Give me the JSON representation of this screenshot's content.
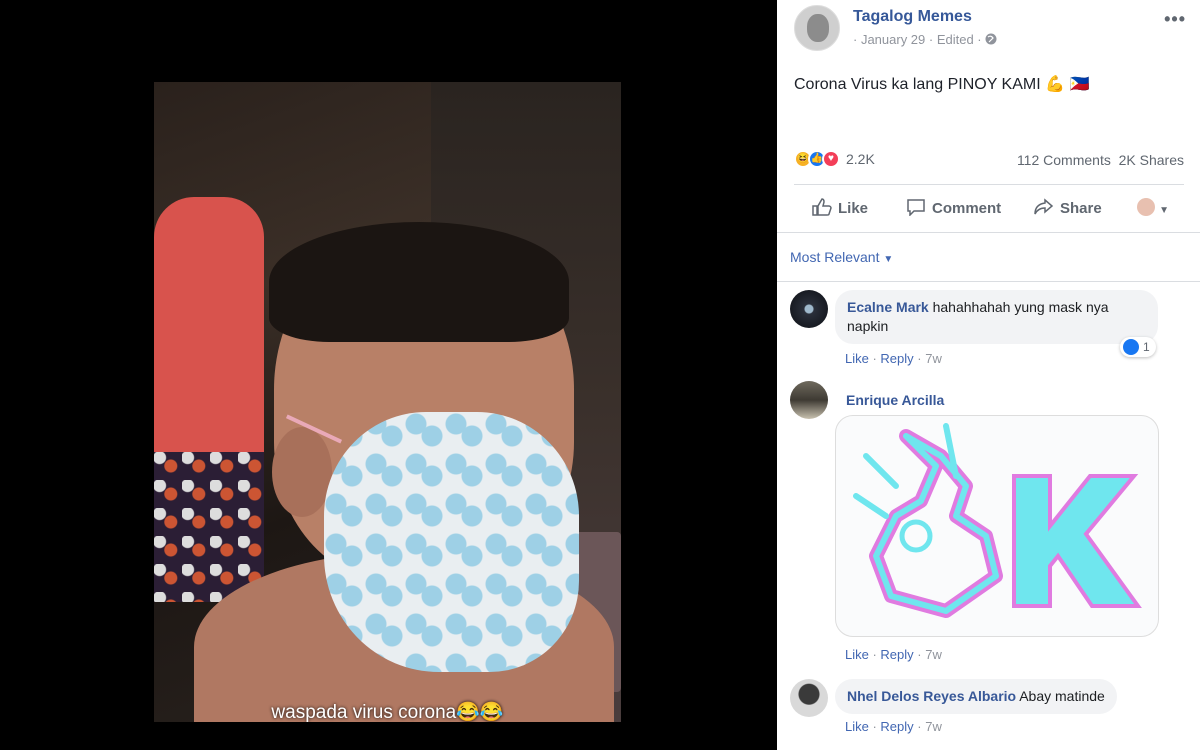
{
  "photo": {
    "caption": "waspada virus corona",
    "caption_emojis": "😂😂"
  },
  "post": {
    "page_name": "Tagalog Memes",
    "meta": "· January 29 · Edited ·",
    "more_icon": "more-dots-icon",
    "text": "Corona Virus ka lang PINOY KAMI 💪 🇵🇭",
    "reactions": {
      "icons": [
        "haha-icon",
        "like-icon",
        "love-icon"
      ],
      "count": "2.2K"
    },
    "comments_count": "112 Comments",
    "shares_count": "2K Shares",
    "actions": {
      "like": "Like",
      "comment": "Comment",
      "share": "Share"
    }
  },
  "comments_filter": {
    "label": "Most Relevant"
  },
  "comments": [
    {
      "author": "Ecalne Mark",
      "text": "hahahhahah yung mask nya napkin",
      "like": "Like",
      "reply": "Reply",
      "time": "7w",
      "reaction_count": "1"
    },
    {
      "author": "Enrique Arcilla",
      "sticker": "ok-hand-k-sticker",
      "like": "Like",
      "reply": "Reply",
      "time": "7w"
    },
    {
      "author": "Nhel Delos Reyes Albario",
      "text": "Abay matinde",
      "like": "Like",
      "reply": "Reply",
      "time": "7w"
    }
  ],
  "colors": {
    "link_blue": "#365899",
    "accent_blue": "#4267b2",
    "like_blue": "#1877f2",
    "love_red": "#f33e58",
    "haha_yellow": "#f7b125",
    "sticker_pink": "#e07be0",
    "sticker_cyan": "#6fe6ee"
  }
}
